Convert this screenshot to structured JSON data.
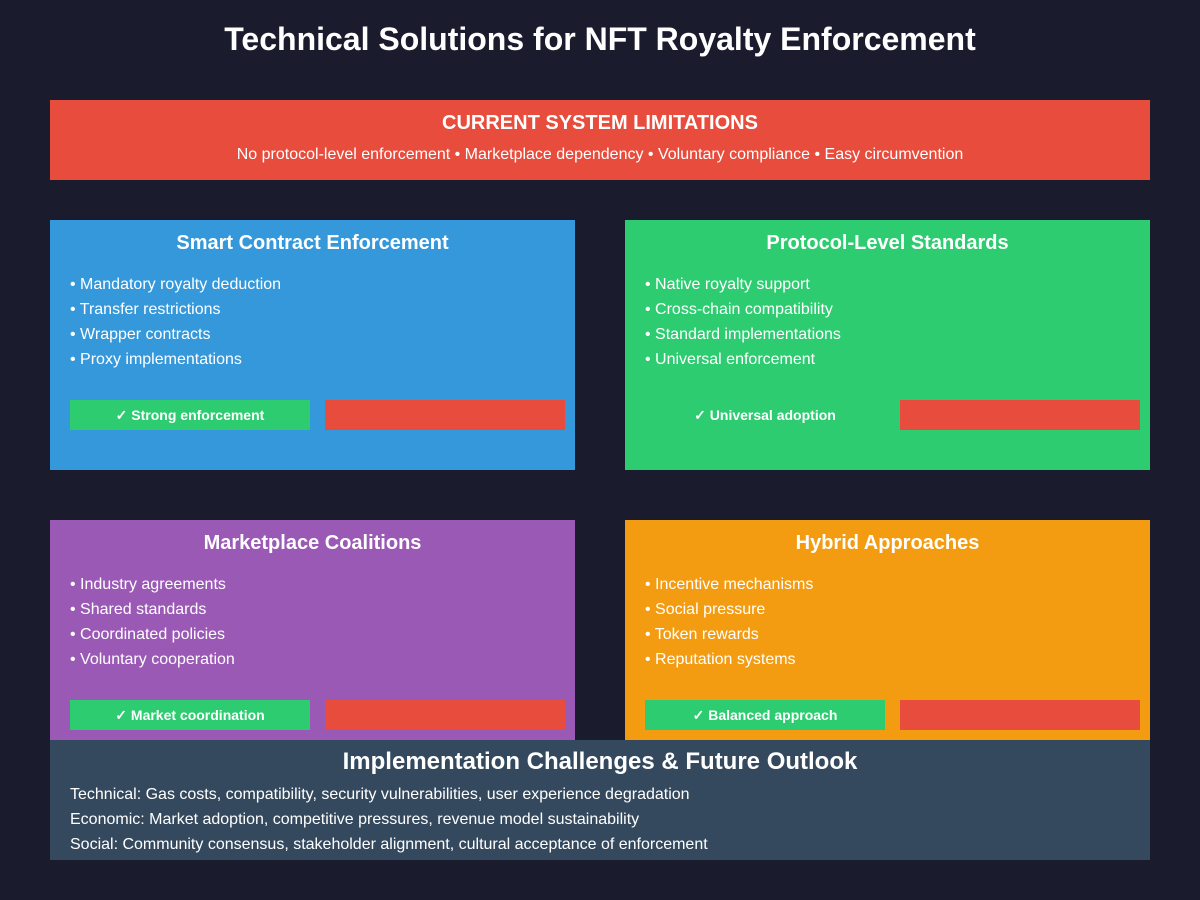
{
  "title": "Technical Solutions for NFT Royalty Enforcement",
  "limitations": {
    "title": "CURRENT SYSTEM LIMITATIONS",
    "subtitle": "No protocol-level enforcement • Marketplace dependency • Voluntary compliance • Easy circumvention",
    "color": "#e74c3c"
  },
  "cards": [
    {
      "title": "Smart Contract Enforcement",
      "color": "#3498db",
      "items": [
        "• Mandatory royalty deduction",
        "• Transfer restrictions",
        "• Wrapper contracts",
        "• Proxy implementations"
      ],
      "pro": "✓ Strong enforcement"
    },
    {
      "title": "Protocol-Level Standards",
      "color": "#2ecc71",
      "items": [
        "• Native royalty support",
        "• Cross-chain compatibility",
        "• Standard implementations",
        "• Universal enforcement"
      ],
      "pro": "✓ Universal adoption"
    },
    {
      "title": "Marketplace Coalitions",
      "color": "#9b59b6",
      "items": [
        "• Industry agreements",
        "• Shared standards",
        "• Coordinated policies",
        "• Voluntary cooperation"
      ],
      "pro": "✓ Market coordination"
    },
    {
      "title": "Hybrid Approaches",
      "color": "#f39c12",
      "items": [
        "• Incentive mechanisms",
        "• Social pressure",
        "• Token rewards",
        "• Reputation systems"
      ],
      "pro": "✓ Balanced approach"
    }
  ],
  "outlook": {
    "title": "Implementation Challenges & Future Outlook",
    "lines": [
      "Technical: Gas costs, compatibility, security vulnerabilities, user experience degradation",
      "Economic: Market adoption, competitive pressures, revenue model sustainability",
      "Social: Community consensus, stakeholder alignment, cultural acceptance of enforcement"
    ]
  },
  "colors": {
    "background": "#1b1b2e",
    "pro": "#2ecc71",
    "con": "#e74c3c",
    "outlook": "#34495e"
  }
}
